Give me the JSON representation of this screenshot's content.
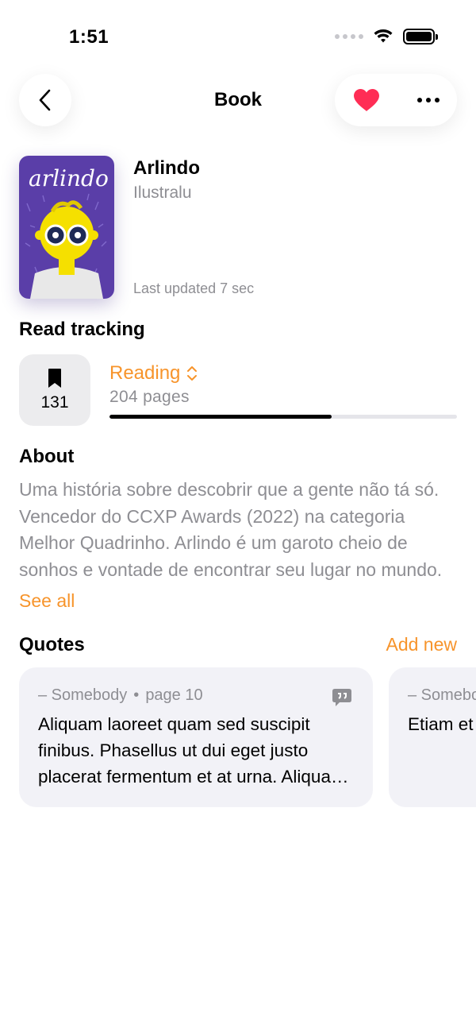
{
  "status_bar": {
    "time": "1:51"
  },
  "nav": {
    "title": "Book",
    "back_icon": "chevron-left-icon",
    "favorite_icon": "heart-icon",
    "more_icon": "ellipsis-icon"
  },
  "book": {
    "title": "Arlindo",
    "author": "Ilustralu",
    "last_updated": "Last updated 7 sec",
    "cover_text": "arlindo"
  },
  "read_tracking": {
    "heading": "Read tracking",
    "bookmark_page": "131",
    "status": "Reading",
    "pages": "204 pages",
    "progress_fraction": 0.64
  },
  "about": {
    "heading": "About",
    "text": "Uma história sobre descobrir que a gente não tá só. Vencedor do CCXP Awards (2022) na categoria Melhor Quadrinho. Arlindo é um garoto cheio de sonhos e vontade de encontrar seu lugar no mundo.",
    "see_all": "See all"
  },
  "quotes": {
    "heading": "Quotes",
    "add_new": "Add new",
    "items": [
      {
        "author": "– Somebody",
        "separator": "•",
        "page": "page 10",
        "text": "Aliquam laoreet quam sed suscipit finibus. Phasellus ut dui eget justo placerat fermentum et at urna. Aliquam erat volutpat."
      },
      {
        "author": "– Somebody",
        "separator": "•",
        "page": "",
        "text": "Etiam et luctus a facilisis"
      }
    ]
  },
  "colors": {
    "accent": "#f7942b",
    "favorite": "#ff2d55",
    "secondary_text": "#8e8e93",
    "card_bg": "#f2f2f7"
  }
}
